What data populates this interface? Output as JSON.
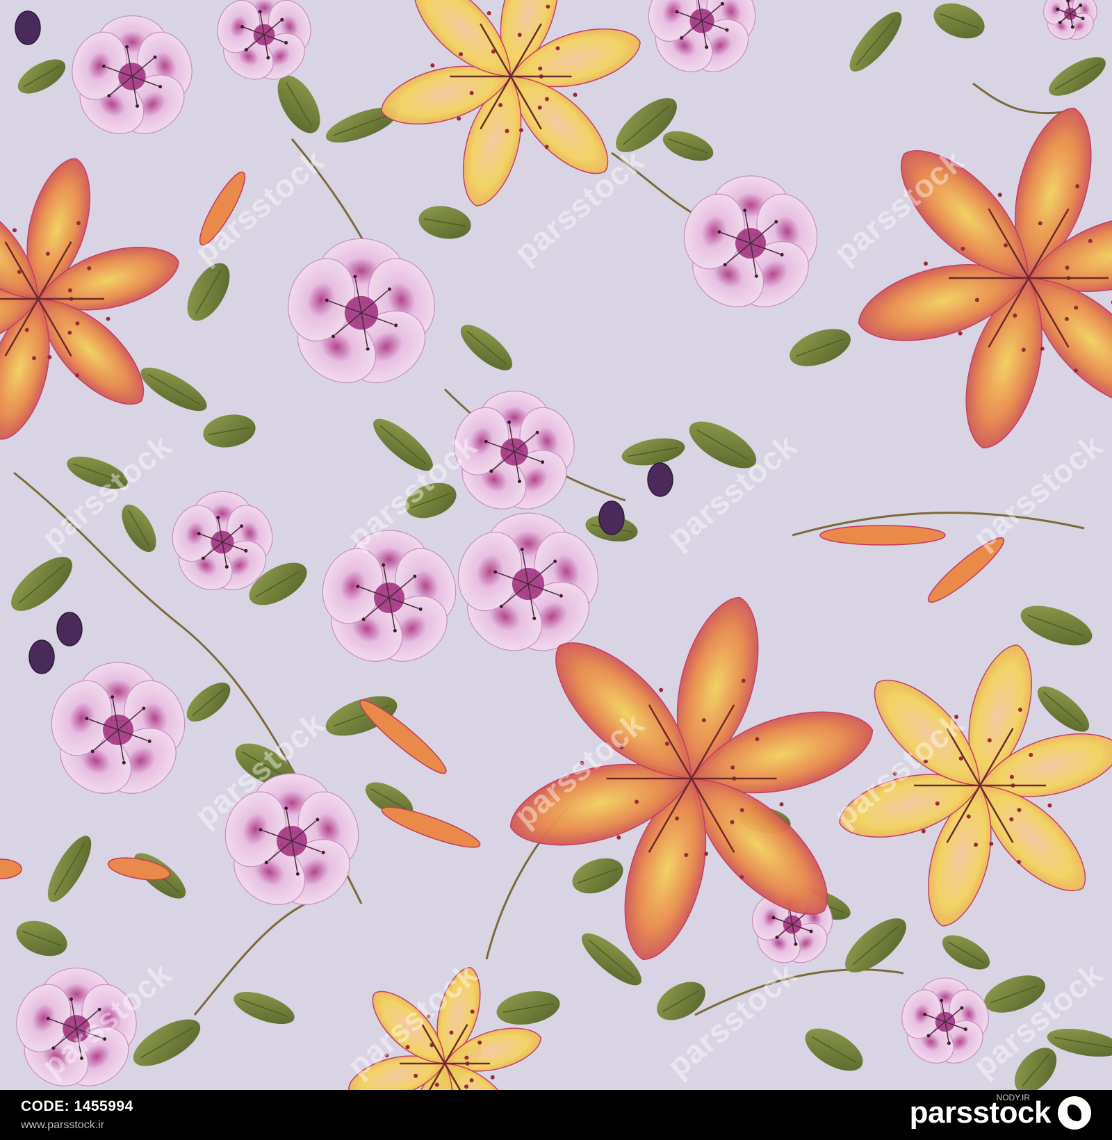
{
  "image": {
    "subject": "seamless watercolor floral pattern",
    "background_color": "#d9d4e3"
  },
  "watermark": {
    "text": "parsstock"
  },
  "footer": {
    "code_label": "CODE:",
    "code_value": "1455994",
    "site": "www.parsstock.ir",
    "brand": "parsstock",
    "corner_tag": "NODY.IR"
  },
  "palette": {
    "leaf": "#6f7f33",
    "leaf_dark": "#4f5e22",
    "pink_flower": "#e6bfe0",
    "pink_center": "#a02b7a",
    "lily_red": "#c23a5e",
    "lily_orange": "#e98a4b",
    "lily_yellow": "#f4d35e",
    "bud": "#4a2a5a"
  }
}
